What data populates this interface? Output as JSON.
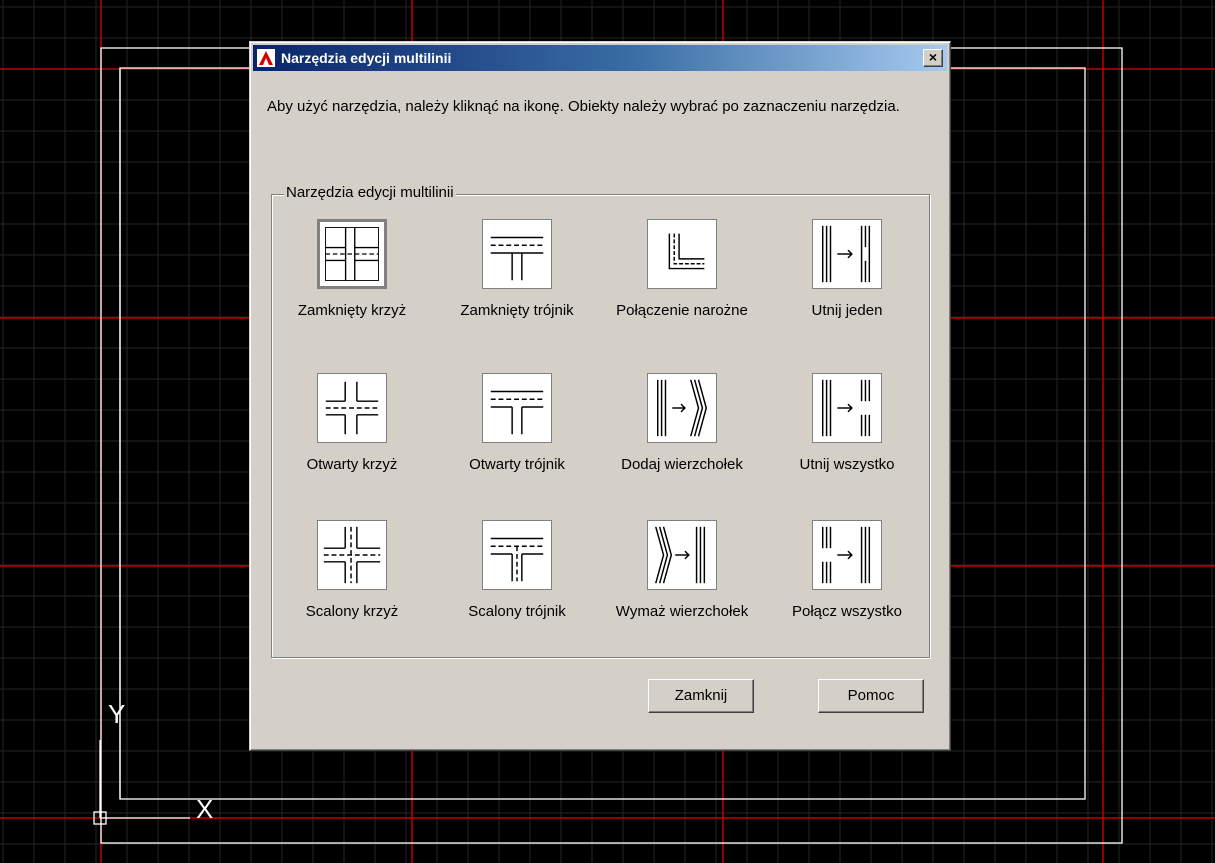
{
  "dialog": {
    "title": "Narzędzia edycji multilinii",
    "close_glyph": "×",
    "instruction": "Aby użyć narzędzia, należy kliknąć na ikonę. Obiekty należy wybrać po zaznaczeniu narzędzia.",
    "group_title": "Narzędzia edycji multilinii",
    "tools": [
      {
        "label": "Zamknięty krzyż",
        "icon": "closed-cross-icon",
        "selected": true
      },
      {
        "label": "Zamknięty trójnik",
        "icon": "closed-tee-icon"
      },
      {
        "label": "Połączenie narożne",
        "icon": "corner-joint-icon"
      },
      {
        "label": "Utnij jeden",
        "icon": "cut-single-icon"
      },
      {
        "label": "Otwarty krzyż",
        "icon": "open-cross-icon"
      },
      {
        "label": "Otwarty trójnik",
        "icon": "open-tee-icon"
      },
      {
        "label": "Dodaj wierzchołek",
        "icon": "add-vertex-icon"
      },
      {
        "label": "Utnij wszystko",
        "icon": "cut-all-icon"
      },
      {
        "label": "Scalony krzyż",
        "icon": "merged-cross-icon"
      },
      {
        "label": "Scalony trójnik",
        "icon": "merged-tee-icon"
      },
      {
        "label": "Wymaż wierzchołek",
        "icon": "delete-vertex-icon"
      },
      {
        "label": "Połącz wszystko",
        "icon": "weld-all-icon"
      }
    ],
    "buttons": {
      "close": "Zamknij",
      "help": "Pomoc"
    }
  },
  "cad": {
    "ucs_y_label": "Y",
    "ucs_x_label": "X"
  },
  "colors": {
    "grid_major": "#c00000",
    "grid_minor": "#2a2a2a",
    "drawing": "#ffffff",
    "title_start": "#0a246a",
    "title_end": "#a6caf0",
    "face": "#d4d0c8"
  }
}
